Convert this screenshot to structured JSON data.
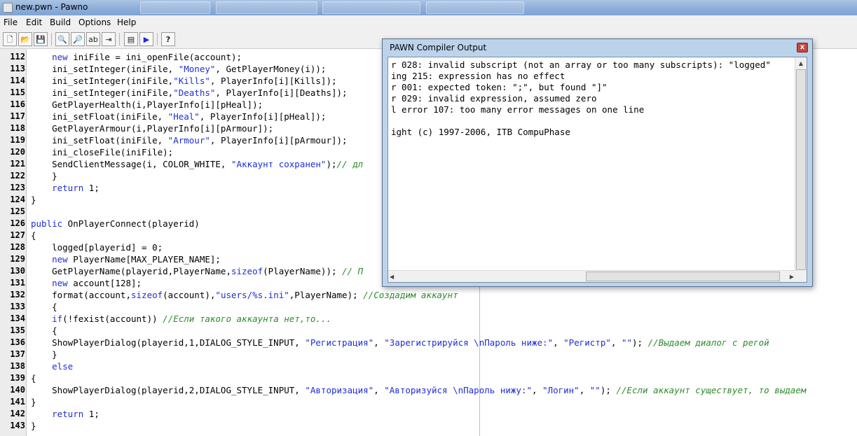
{
  "window": {
    "title": "new.pwn - Pawno"
  },
  "menu": {
    "items": [
      "File",
      "Edit",
      "Build",
      "Options",
      "Help"
    ]
  },
  "toolbar": {
    "buttons": [
      {
        "name": "new-file",
        "glyph": "🗋"
      },
      {
        "name": "open-file",
        "glyph": "📂"
      },
      {
        "name": "save-file",
        "glyph": "💾"
      },
      {
        "name": "find",
        "glyph": "🔍"
      },
      {
        "name": "find-next",
        "glyph": "🔎"
      },
      {
        "name": "replace",
        "glyph": "ab"
      },
      {
        "name": "goto-line",
        "glyph": "⇥"
      },
      {
        "name": "function-list",
        "glyph": "▤"
      },
      {
        "name": "compile",
        "glyph": "▶"
      },
      {
        "name": "help",
        "glyph": "?"
      }
    ]
  },
  "editor": {
    "lines": [
      {
        "n": "112",
        "segs": [
          [
            "",
            "    "
          ],
          [
            "k",
            "new"
          ],
          [
            "",
            " iniFile = ini_openFile(account);"
          ]
        ]
      },
      {
        "n": "113",
        "segs": [
          [
            "",
            "    ini_setInteger(iniFile, "
          ],
          [
            "s",
            "\"Money\""
          ],
          [
            "",
            ", GetPlayerMoney(i));"
          ]
        ]
      },
      {
        "n": "114",
        "segs": [
          [
            "",
            "    ini_setInteger(iniFile,"
          ],
          [
            "s",
            "\"Kills\""
          ],
          [
            "",
            ", PlayerInfo[i][Kills]);"
          ]
        ]
      },
      {
        "n": "115",
        "segs": [
          [
            "",
            "    ini_setInteger(iniFile,"
          ],
          [
            "s",
            "\"Deaths\""
          ],
          [
            "",
            ", PlayerInfo[i][Deaths]);"
          ]
        ]
      },
      {
        "n": "116",
        "segs": [
          [
            "",
            "    GetPlayerHealth(i,PlayerInfo[i][pHeal]);"
          ]
        ]
      },
      {
        "n": "117",
        "segs": [
          [
            "",
            "    ini_setFloat(iniFile, "
          ],
          [
            "s",
            "\"Heal\""
          ],
          [
            "",
            ", PlayerInfo[i][pHeal]);"
          ]
        ]
      },
      {
        "n": "118",
        "segs": [
          [
            "",
            "    GetPlayerArmour(i,PlayerInfo[i][pArmour]);"
          ]
        ]
      },
      {
        "n": "119",
        "segs": [
          [
            "",
            "    ini_setFloat(iniFile, "
          ],
          [
            "s",
            "\"Armour\""
          ],
          [
            "",
            ", PlayerInfo[i][pArmour]);"
          ]
        ]
      },
      {
        "n": "120",
        "segs": [
          [
            "",
            "    ini_closeFile(iniFile);"
          ]
        ]
      },
      {
        "n": "121",
        "segs": [
          [
            "",
            "    SendClientMessage(i, COLOR_WHITE, "
          ],
          [
            "s",
            "\"Аккаунт сохранен\""
          ],
          [
            "",
            ");"
          ],
          [
            "c",
            "// дл"
          ]
        ]
      },
      {
        "n": "122",
        "segs": [
          [
            "",
            "    }"
          ]
        ]
      },
      {
        "n": "123",
        "segs": [
          [
            "",
            "    "
          ],
          [
            "k",
            "return"
          ],
          [
            "",
            " 1;"
          ]
        ]
      },
      {
        "n": "124",
        "segs": [
          [
            "",
            "}"
          ]
        ]
      },
      {
        "n": "125",
        "segs": [
          [
            "",
            ""
          ]
        ]
      },
      {
        "n": "126",
        "segs": [
          [
            "k",
            "public"
          ],
          [
            "",
            " OnPlayerConnect(playerid)"
          ]
        ]
      },
      {
        "n": "127",
        "segs": [
          [
            "",
            "{"
          ]
        ]
      },
      {
        "n": "128",
        "segs": [
          [
            "",
            "    logged[playerid] = 0;"
          ]
        ]
      },
      {
        "n": "129",
        "segs": [
          [
            "",
            "    "
          ],
          [
            "k",
            "new"
          ],
          [
            "",
            " PlayerName[MAX_PLAYER_NAME];"
          ]
        ]
      },
      {
        "n": "130",
        "segs": [
          [
            "",
            "    GetPlayerName(playerid,PlayerName,"
          ],
          [
            "k",
            "sizeof"
          ],
          [
            "",
            "(PlayerName)); "
          ],
          [
            "c",
            "// П"
          ]
        ]
      },
      {
        "n": "131",
        "segs": [
          [
            "",
            "    "
          ],
          [
            "k",
            "new"
          ],
          [
            "",
            " account[128];"
          ]
        ]
      },
      {
        "n": "132",
        "segs": [
          [
            "",
            "    format(account,"
          ],
          [
            "k",
            "sizeof"
          ],
          [
            "",
            "(account),"
          ],
          [
            "s",
            "\"users/%s.ini\""
          ],
          [
            "",
            ",PlayerName); "
          ],
          [
            "c",
            "//Создадим аккаунт"
          ]
        ]
      },
      {
        "n": "133",
        "segs": [
          [
            "",
            "    {"
          ]
        ]
      },
      {
        "n": "134",
        "segs": [
          [
            "",
            "    "
          ],
          [
            "k",
            "if"
          ],
          [
            "",
            "(!fexist(account)) "
          ],
          [
            "c",
            "//Если такого аккаунта нет,то..."
          ]
        ]
      },
      {
        "n": "135",
        "segs": [
          [
            "",
            "    {"
          ]
        ]
      },
      {
        "n": "136",
        "segs": [
          [
            "",
            "    ShowPlayerDialog(playerid,1,DIALOG_STYLE_INPUT, "
          ],
          [
            "s",
            "\"Регистрация\""
          ],
          [
            "",
            ", "
          ],
          [
            "s",
            "\"Зарегистрируйся \\nПароль ниже:\""
          ],
          [
            "",
            ", "
          ],
          [
            "s",
            "\"Регистр\""
          ],
          [
            "",
            ", "
          ],
          [
            "s",
            "\"\""
          ],
          [
            "",
            "); "
          ],
          [
            "c",
            "//Выдаем диалог с регой"
          ]
        ]
      },
      {
        "n": "137",
        "segs": [
          [
            "",
            "    }"
          ]
        ]
      },
      {
        "n": "138",
        "segs": [
          [
            "",
            "    "
          ],
          [
            "k",
            "else"
          ]
        ]
      },
      {
        "n": "139",
        "segs": [
          [
            "",
            "{"
          ]
        ]
      },
      {
        "n": "140",
        "segs": [
          [
            "",
            "    ShowPlayerDialog(playerid,2,DIALOG_STYLE_INPUT, "
          ],
          [
            "s",
            "\"Авторизация\""
          ],
          [
            "",
            ", "
          ],
          [
            "s",
            "\"Авторизуйся \\nПароль нижу:\""
          ],
          [
            "",
            ", "
          ],
          [
            "s",
            "\"Логин\""
          ],
          [
            "",
            ", "
          ],
          [
            "s",
            "\"\""
          ],
          [
            "",
            "); "
          ],
          [
            "c",
            "//Если аккаунт существует, то выдаем"
          ]
        ]
      },
      {
        "n": "141",
        "segs": [
          [
            "",
            "}"
          ]
        ]
      },
      {
        "n": "142",
        "segs": [
          [
            "",
            "    "
          ],
          [
            "k",
            "return"
          ],
          [
            "",
            " 1;"
          ]
        ]
      },
      {
        "n": "143",
        "segs": [
          [
            "",
            "}"
          ]
        ]
      }
    ]
  },
  "compiler": {
    "title": "PAWN Compiler Output",
    "close_label": "x",
    "lines": [
      "r 028: invalid subscript (not an array or too many subscripts): \"logged\"",
      "ing 215: expression has no effect",
      "r 001: expected token: \";\", but found \"]\"",
      "r 029: invalid expression, assumed zero",
      "l error 107: too many error messages on one line",
      "",
      "ight (c) 1997-2006, ITB CompuPhase"
    ]
  },
  "colors": {
    "keyword": "#1e2ed4",
    "string": "#1e2ed4",
    "comment": "#2e8b2e"
  }
}
